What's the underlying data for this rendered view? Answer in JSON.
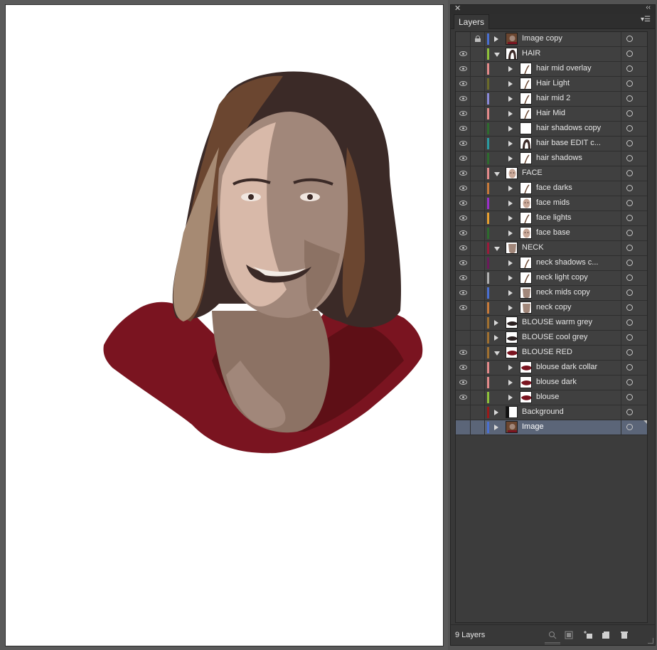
{
  "panel": {
    "tab_label": "Layers",
    "footer_count": "9 Layers"
  },
  "layers": [
    {
      "name": "Image copy",
      "visible": false,
      "locked": true,
      "depth": 0,
      "expanded": false,
      "color": "#4a6fd1",
      "thumb": "photo"
    },
    {
      "name": "HAIR",
      "visible": true,
      "locked": false,
      "depth": 0,
      "expanded": true,
      "color": "#8fc23a",
      "thumb": "hair"
    },
    {
      "name": "hair mid overlay",
      "visible": true,
      "locked": false,
      "depth": 1,
      "expanded": false,
      "color": "#e48a8a",
      "thumb": "stroke"
    },
    {
      "name": "Hair Light",
      "visible": true,
      "locked": false,
      "depth": 1,
      "expanded": false,
      "color": "#6b6b2a",
      "thumb": "stroke"
    },
    {
      "name": "hair mid 2",
      "visible": true,
      "locked": false,
      "depth": 1,
      "expanded": false,
      "color": "#8a8ad8",
      "thumb": "stroke"
    },
    {
      "name": "Hair Mid",
      "visible": true,
      "locked": false,
      "depth": 1,
      "expanded": false,
      "color": "#e48a8a",
      "thumb": "stroke"
    },
    {
      "name": "hair shadows copy",
      "visible": true,
      "locked": false,
      "depth": 1,
      "expanded": false,
      "color": "#2e6b2e",
      "thumb": "blank"
    },
    {
      "name": "hair base EDIT c...",
      "visible": true,
      "locked": false,
      "depth": 1,
      "expanded": false,
      "color": "#2a9aa0",
      "thumb": "hair"
    },
    {
      "name": "hair shadows",
      "visible": true,
      "locked": false,
      "depth": 1,
      "expanded": false,
      "color": "#2e6b2e",
      "thumb": "stroke"
    },
    {
      "name": "FACE",
      "visible": true,
      "locked": false,
      "depth": 0,
      "expanded": true,
      "color": "#e48a8a",
      "thumb": "face"
    },
    {
      "name": "face darks",
      "visible": true,
      "locked": false,
      "depth": 1,
      "expanded": false,
      "color": "#c87a3a",
      "thumb": "stroke"
    },
    {
      "name": "face mids",
      "visible": true,
      "locked": false,
      "depth": 1,
      "expanded": false,
      "color": "#9a30c8",
      "thumb": "face"
    },
    {
      "name": "face lights",
      "visible": true,
      "locked": false,
      "depth": 1,
      "expanded": false,
      "color": "#e8a030",
      "thumb": "stroke"
    },
    {
      "name": "face base",
      "visible": true,
      "locked": false,
      "depth": 1,
      "expanded": false,
      "color": "#2e6b2e",
      "thumb": "face"
    },
    {
      "name": "NECK",
      "visible": true,
      "locked": false,
      "depth": 0,
      "expanded": true,
      "color": "#9a1a3a",
      "thumb": "skin"
    },
    {
      "name": "neck shadows c...",
      "visible": true,
      "locked": false,
      "depth": 1,
      "expanded": false,
      "color": "#6a1a5a",
      "thumb": "stroke"
    },
    {
      "name": "neck light copy",
      "visible": true,
      "locked": false,
      "depth": 1,
      "expanded": false,
      "color": "#b0b0b0",
      "thumb": "stroke"
    },
    {
      "name": "neck mids copy",
      "visible": true,
      "locked": false,
      "depth": 1,
      "expanded": false,
      "color": "#4a6fd1",
      "thumb": "skin"
    },
    {
      "name": "neck copy",
      "visible": true,
      "locked": false,
      "depth": 1,
      "expanded": false,
      "color": "#c87a3a",
      "thumb": "skin"
    },
    {
      "name": "BLOUSE warm grey",
      "visible": false,
      "locked": false,
      "depth": 0,
      "expanded": false,
      "color": "#a07030",
      "thumb": "darkshape"
    },
    {
      "name": "BLOUSE cool grey",
      "visible": false,
      "locked": false,
      "depth": 0,
      "expanded": false,
      "color": "#a07030",
      "thumb": "darkshape"
    },
    {
      "name": "BLOUSE RED",
      "visible": true,
      "locked": false,
      "depth": 0,
      "expanded": true,
      "color": "#a07030",
      "thumb": "red"
    },
    {
      "name": "blouse dark collar",
      "visible": true,
      "locked": false,
      "depth": 1,
      "expanded": false,
      "color": "#e48a8a",
      "thumb": "red"
    },
    {
      "name": "blouse dark",
      "visible": true,
      "locked": false,
      "depth": 1,
      "expanded": false,
      "color": "#e48a8a",
      "thumb": "red"
    },
    {
      "name": "blouse",
      "visible": true,
      "locked": false,
      "depth": 1,
      "expanded": false,
      "color": "#8fc23a",
      "thumb": "red"
    },
    {
      "name": "Background",
      "visible": false,
      "locked": false,
      "depth": 0,
      "expanded": false,
      "color": "#9a1a1a",
      "thumb": "bg"
    },
    {
      "name": "Image",
      "visible": false,
      "locked": false,
      "depth": 0,
      "expanded": false,
      "color": "#4a6fd1",
      "thumb": "photo",
      "selected": true
    }
  ],
  "footer_tools": [
    "locate-object-icon",
    "make-clipping-mask-icon",
    "create-sublayer-icon",
    "create-new-layer-icon",
    "delete-layer-icon"
  ],
  "colors": {
    "hair_dark": "#3b2a27",
    "hair_mid": "#6b4630",
    "hair_light": "#a68a73",
    "skin_base": "#a1877a",
    "skin_light": "#d8b9a9",
    "skin_mid": "#8c7264",
    "blouse_red": "#7a1420",
    "blouse_dark": "#5e0f16",
    "panel_bg": "#383838",
    "selected_row": "#5b6578"
  }
}
